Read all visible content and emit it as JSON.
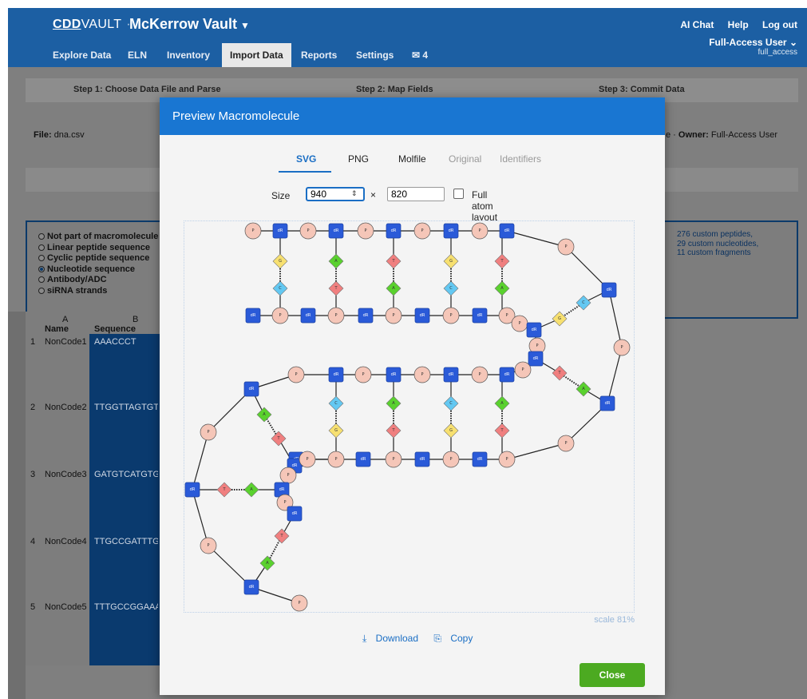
{
  "header": {
    "brand": {
      "cdd": "CDD",
      "vault": "VAULT",
      "sep": "·"
    },
    "vault_name": "McKerrow Vault",
    "top_links": [
      "AI Chat",
      "Help",
      "Log out"
    ],
    "nav": [
      "Explore Data",
      "ELN",
      "Inventory",
      "Import Data",
      "Reports",
      "Settings"
    ],
    "messages_count": "4",
    "user": {
      "name": "Full-Access User",
      "login": "full_access"
    }
  },
  "steps": [
    "Step 1: Choose Data File and Parse",
    "Step 2: Map Fields",
    "Step 3: Commit Data"
  ],
  "file": {
    "label": "File:",
    "name": "dna.csv"
  },
  "owner": {
    "prefix": "e",
    "label": "Owner:",
    "name": "Full-Access User"
  },
  "sequence_types": [
    "Not part of macromolecule",
    "Linear peptide sequence",
    "Cyclic peptide sequence",
    "Nucleotide sequence",
    "Antibody/ADC",
    "siRNA strands"
  ],
  "custom_counts": [
    "276 custom peptides,",
    "29 custom nucleotides,",
    "11 custom fragments"
  ],
  "grid": {
    "col_letters": [
      "A",
      "B"
    ],
    "col_names": [
      "Name",
      "Sequence"
    ],
    "rows": [
      {
        "n": "1",
        "name": "NonCode1",
        "seq": "AAACCCT"
      },
      {
        "n": "2",
        "name": "NonCode2",
        "seq": "TTGGTTAGTGTT"
      },
      {
        "n": "3",
        "name": "NonCode3",
        "seq": "GATGTCATGTGT"
      },
      {
        "n": "4",
        "name": "NonCode4",
        "seq": "TTGCCGATTTGC"
      },
      {
        "n": "5",
        "name": "NonCode5",
        "seq": "TTTGCCGGAAAT"
      }
    ]
  },
  "modal": {
    "title": "Preview Macromolecule",
    "tabs": [
      "SVG",
      "PNG",
      "Molfile",
      "Original",
      "Identifiers"
    ],
    "size_label": "Size",
    "width": "940",
    "times": "×",
    "height": "820",
    "full_atom_label": "Full atom layout",
    "scale": "scale 81%",
    "download": "Download",
    "copy": "Copy",
    "close": "Close"
  },
  "structure": {
    "sugar": "dR",
    "phosphate": "P",
    "bases": [
      "A",
      "C",
      "G",
      "T"
    ],
    "colors": {
      "sugar": "#2a5ad8",
      "phosphate": "#f5c6b8",
      "A": "#5ad12e",
      "C": "#63c8f2",
      "G": "#f7e070",
      "T": "#f07f7f",
      "bond_hbond": "#333333"
    }
  },
  "colors": {
    "header": "#1c5fa3",
    "modal_head": "#1976d2",
    "accent": "#1a6ec4",
    "close": "#4caa21"
  }
}
